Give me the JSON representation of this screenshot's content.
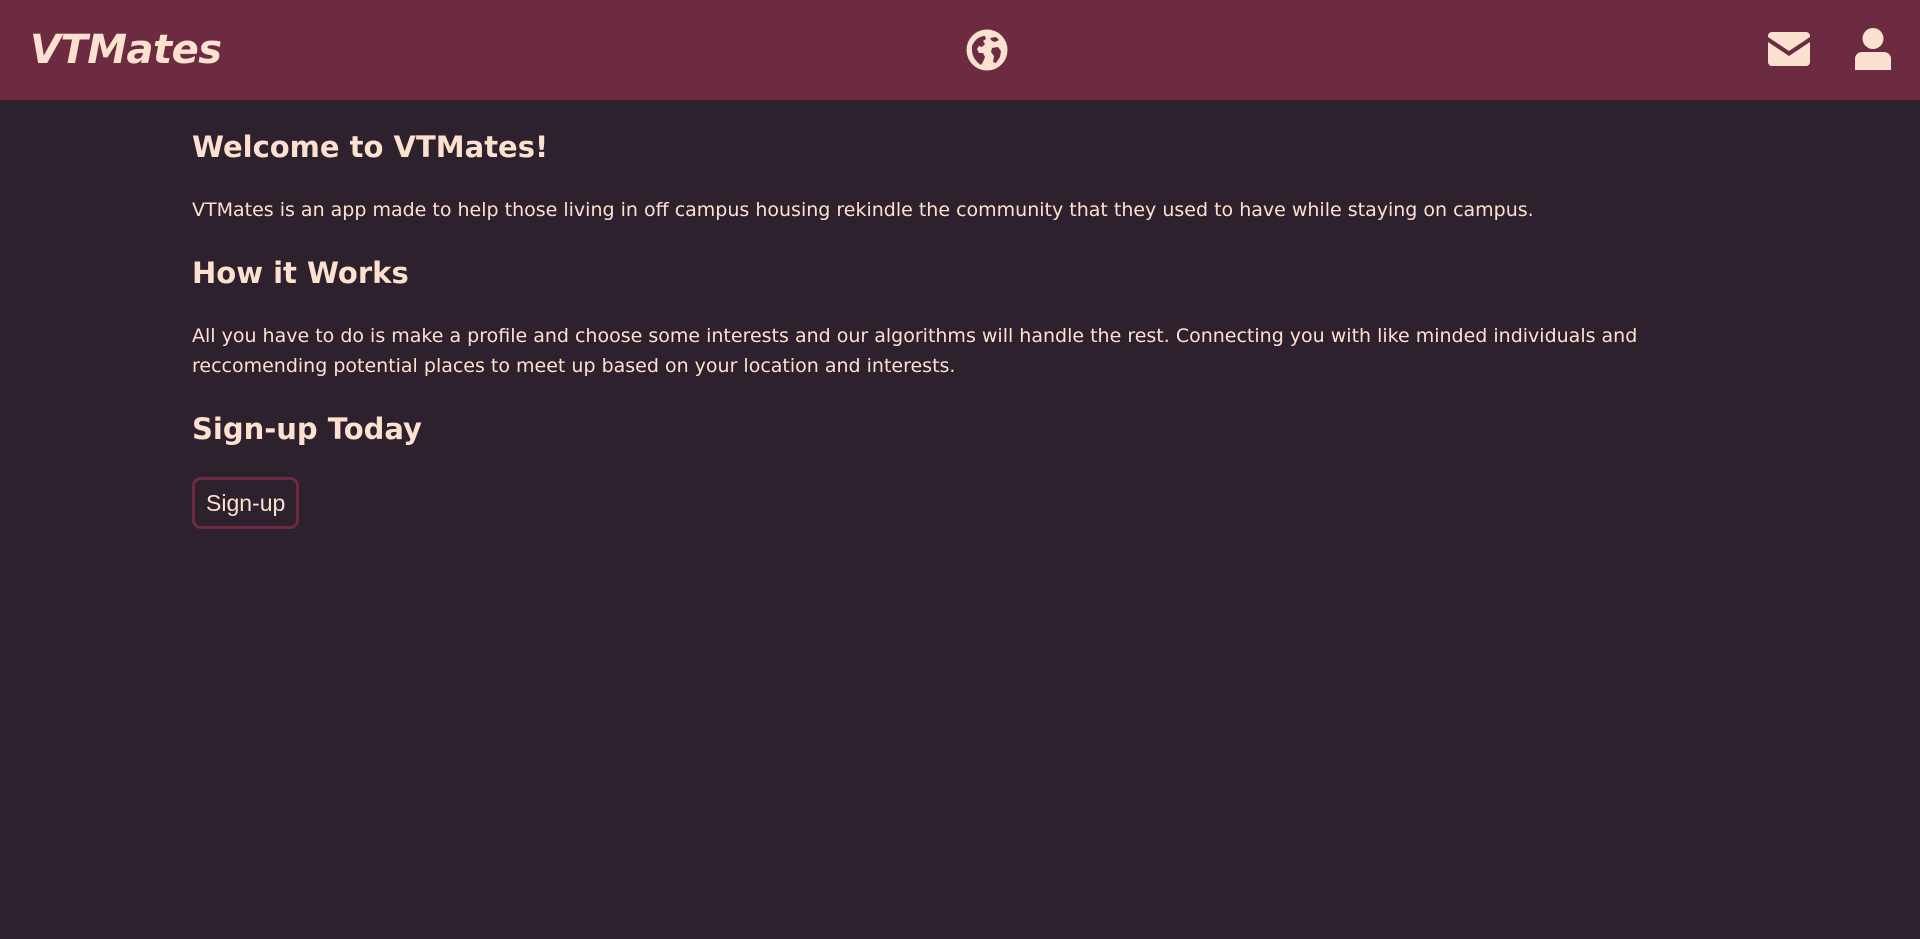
{
  "colors": {
    "navbar_bg": "#6d2b42",
    "page_bg": "#2d212d",
    "text": "#fde1d0",
    "button_border": "#6d2b42"
  },
  "navbar": {
    "brand": "VTMates",
    "icons": [
      "globe-icon",
      "envelope-icon",
      "user-icon"
    ]
  },
  "main": {
    "welcome_title": "Welcome to VTMates!",
    "welcome_text": "VTMates is an app made to help those living in off campus housing rekindle the community that they used to have while staying on campus.",
    "how_title": "How it Works",
    "how_text": "All you have to do is make a profile and choose some interests and our algorithms will handle the rest. Connecting you with like minded individuals and reccomending potential places to meet up based on your location and interests.",
    "signup_title": "Sign-up Today",
    "signup_button": "Sign-up"
  }
}
